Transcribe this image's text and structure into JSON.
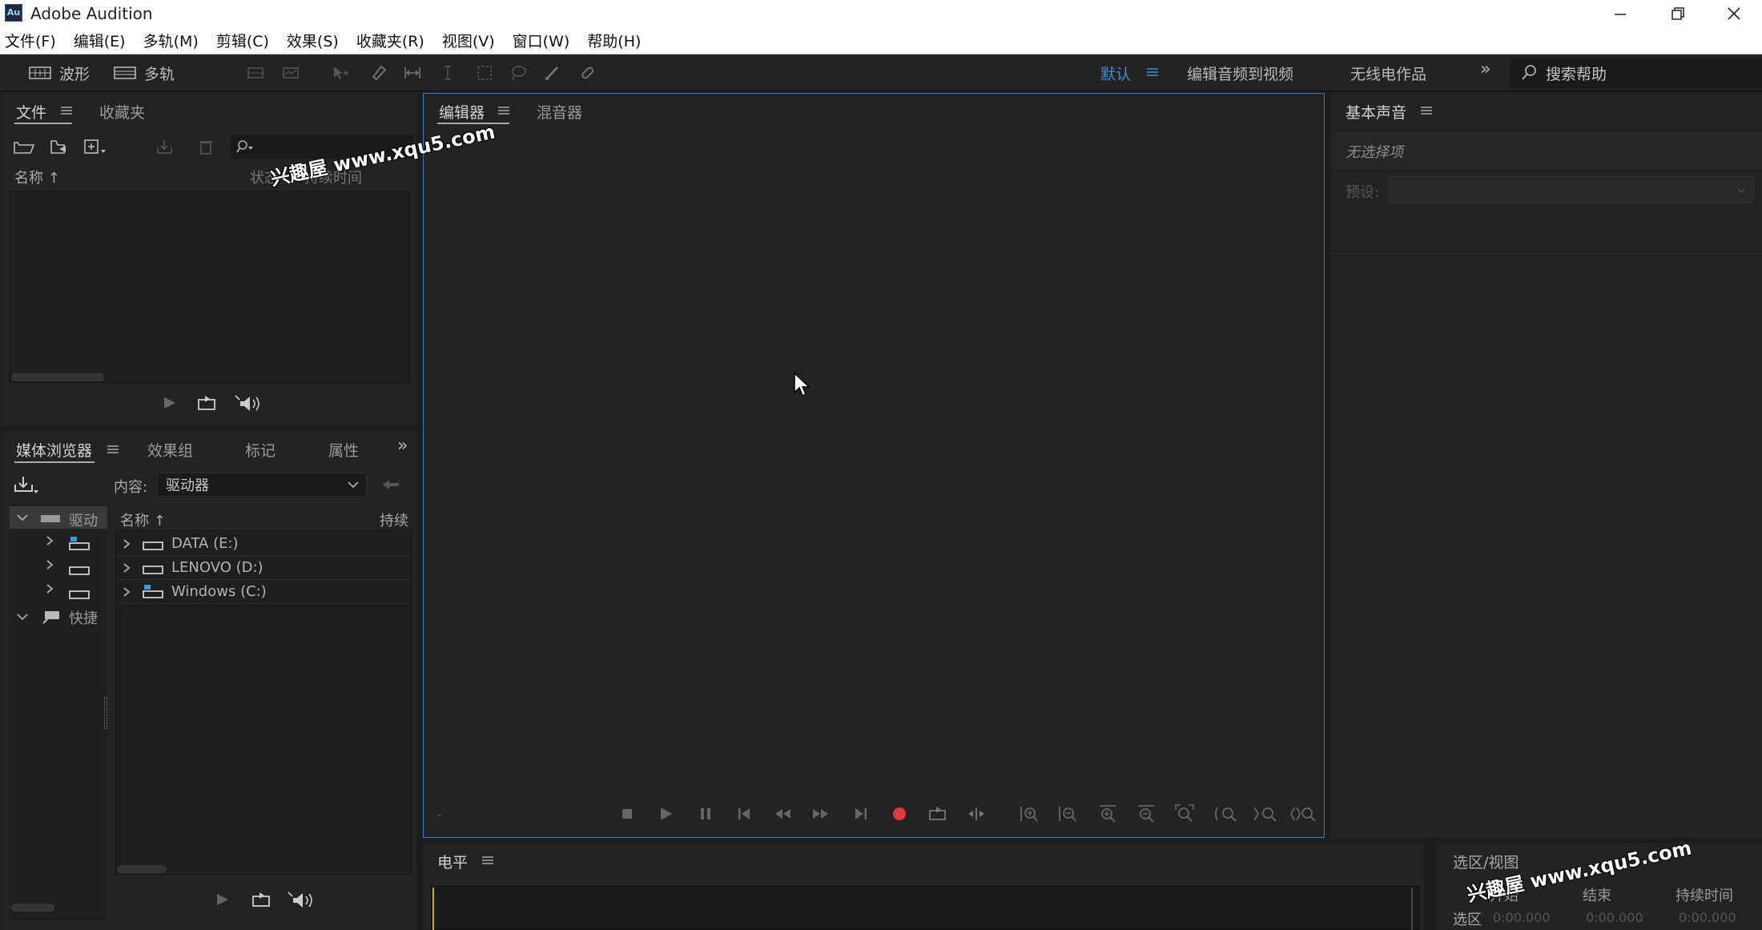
{
  "app": {
    "title": "Adobe Audition",
    "logo_text": "Au"
  },
  "menu": [
    "文件(F)",
    "编辑(E)",
    "多轨(M)",
    "剪辑(C)",
    "效果(S)",
    "收藏夹(R)",
    "视图(V)",
    "窗口(W)",
    "帮助(H)"
  ],
  "toolbar": {
    "waveform_label": "波形",
    "multitrack_label": "多轨"
  },
  "workspaces": {
    "default": "默认",
    "edit_av": "编辑音频到视频",
    "radio": "无线电作品",
    "more": "»"
  },
  "search": {
    "placeholder": "搜索帮助"
  },
  "files_panel": {
    "tab_files": "文件",
    "tab_favorites": "收藏夹",
    "col_name": "名称 ↑",
    "col_status": "状态",
    "col_duration": "持续时间"
  },
  "media_panel": {
    "tab_media": "媒体浏览器",
    "tab_effects": "效果组",
    "tab_markers": "标记",
    "tab_props": "属性",
    "more": "»",
    "content_label": "内容:",
    "content_value": "驱动器",
    "col_name": "名称 ↑",
    "col_duration": "持续",
    "tree_drives": "驱动",
    "tree_shortcuts": "快捷",
    "drives": [
      "DATA (E:)",
      "LENOVO (D:)",
      "Windows (C:)"
    ]
  },
  "editor": {
    "tab_editor": "编辑器",
    "tab_mixer": "混音器",
    "time_marker": "-"
  },
  "essential_sound": {
    "title": "基本声音",
    "no_selection": "无选择项",
    "preset_label": "预设:"
  },
  "level": {
    "title": "电平"
  },
  "selection": {
    "title": "选区/视图",
    "col_start": "开始",
    "col_end": "结束",
    "col_duration": "持续时间",
    "row_label": "选区",
    "start": "0:00.000",
    "end": "0:00.000",
    "duration": "0:00.000"
  },
  "watermark": {
    "text": "兴趣屋 www.xqu5.com"
  },
  "colors": {
    "accent": "#3e8ed0",
    "record": "#e23b3b",
    "panel": "#232323",
    "bg": "#1d1d1d"
  }
}
